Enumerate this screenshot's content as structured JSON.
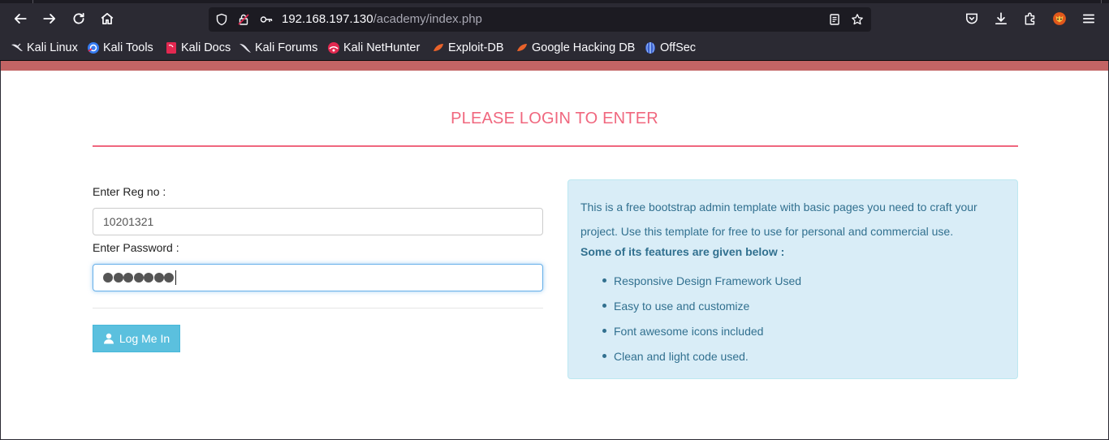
{
  "browser": {
    "url_host": "192.168.197.130",
    "url_path": "/academy/index.php",
    "bookmarks": [
      {
        "label": "Kali Linux",
        "icon": "kali-dragon-icon"
      },
      {
        "label": "Kali Tools",
        "icon": "kali-tools-icon"
      },
      {
        "label": "Kali Docs",
        "icon": "kali-docs-icon"
      },
      {
        "label": "Kali Forums",
        "icon": "kali-forums-icon"
      },
      {
        "label": "Kali NetHunter",
        "icon": "kali-nethunter-icon"
      },
      {
        "label": "Exploit-DB",
        "icon": "exploit-db-icon"
      },
      {
        "label": "Google Hacking DB",
        "icon": "ghdb-icon"
      },
      {
        "label": "OffSec",
        "icon": "offsec-icon"
      }
    ]
  },
  "page": {
    "heading": "PLEASE LOGIN TO ENTER",
    "form": {
      "reg_label": "Enter Reg no :",
      "reg_value": "10201321",
      "password_label": "Enter Password :",
      "password_length": 7,
      "login_label": "Log Me In"
    },
    "info": {
      "text": "This is a free bootstrap admin template with basic pages you need to craft your project. Use this template for free to use for personal and commercial use.",
      "features_heading": "Some of its features are given below :",
      "features": [
        "Responsive Design Framework Used",
        "Easy to use and customize",
        "Font awesome icons included",
        "Clean and light code used."
      ]
    }
  },
  "colors": {
    "accent": "#f0677e",
    "top_band": "#c36464",
    "button": "#5bc0de",
    "info_bg": "#d9edf7",
    "info_text": "#31708f"
  }
}
